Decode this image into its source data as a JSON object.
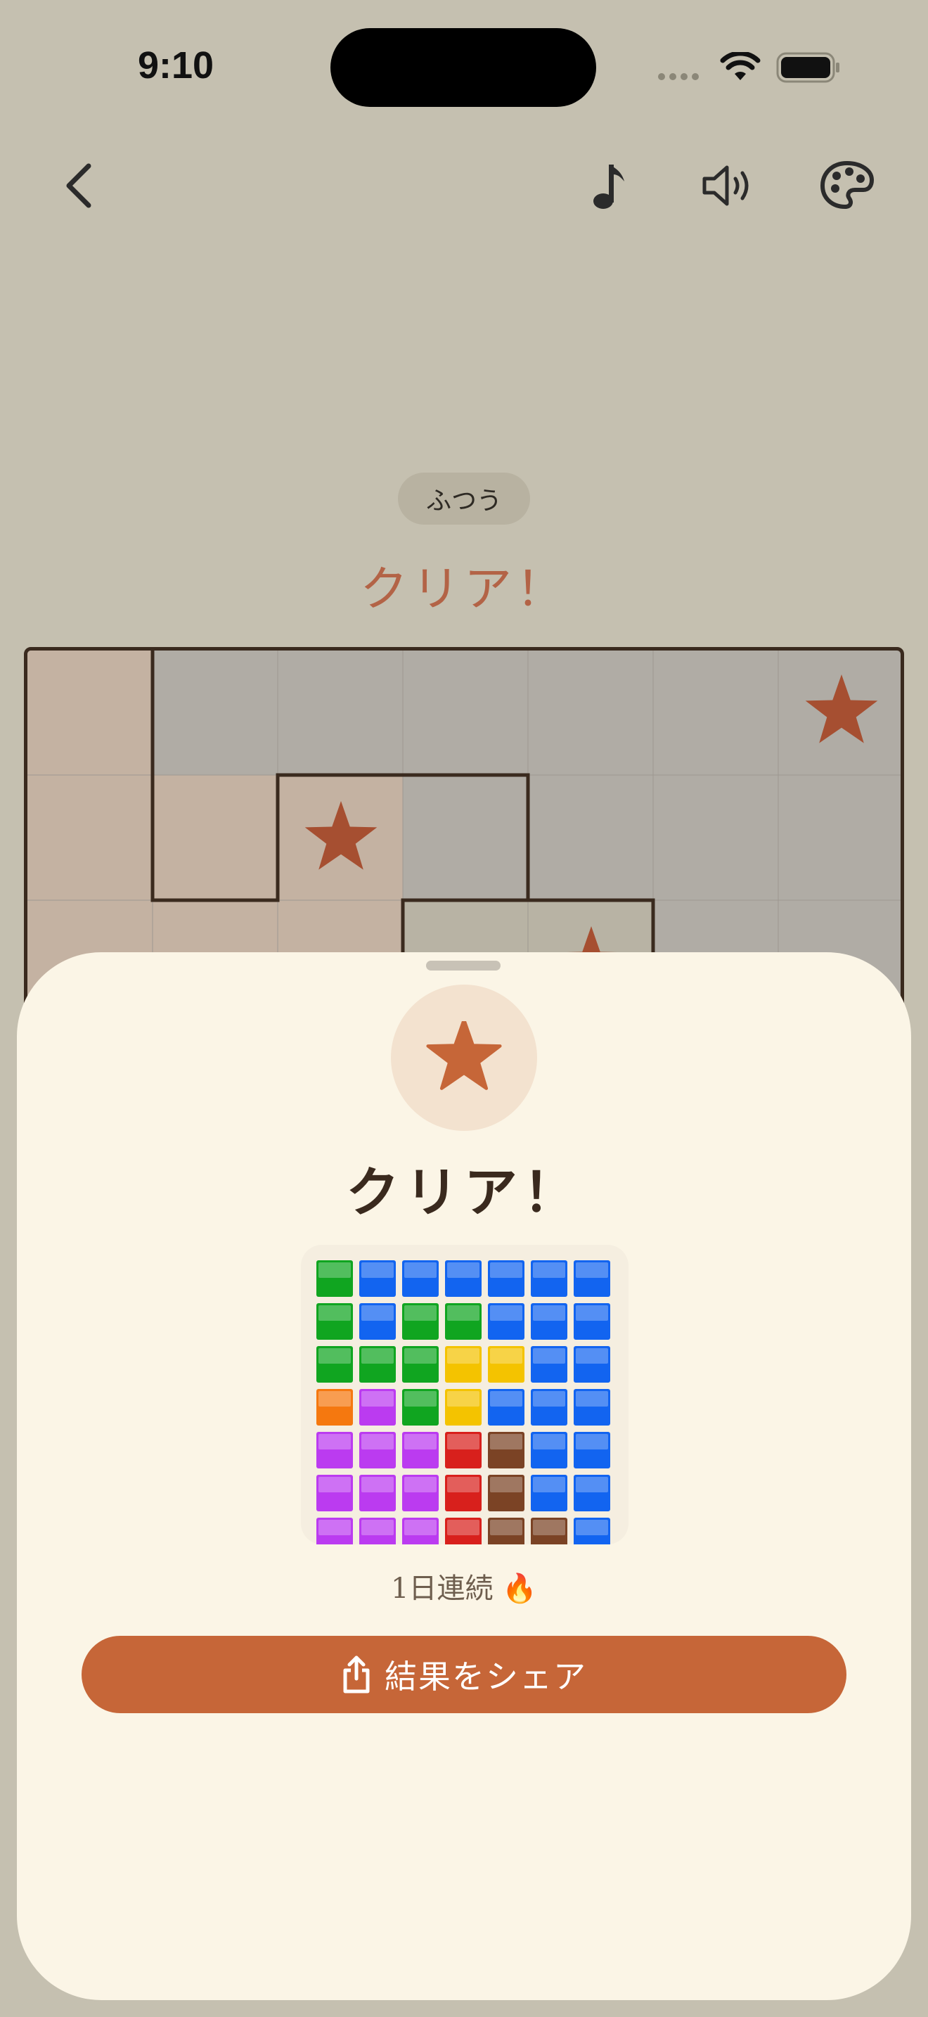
{
  "status_bar": {
    "time": "9:10"
  },
  "nav": {
    "back_icon": "chevron-left-icon",
    "music_icon": "music-note-icon",
    "sound_icon": "speaker-icon",
    "palette_icon": "palette-icon"
  },
  "board": {
    "difficulty": "ふつう",
    "title": "クリア！",
    "star_color": "#a64f31"
  },
  "result_sheet": {
    "title": "クリア！",
    "star_icon": "star-icon",
    "mosaic_rows": [
      [
        "green",
        "blue",
        "blue",
        "blue",
        "blue",
        "blue",
        "blue"
      ],
      [
        "green",
        "blue",
        "green",
        "green",
        "blue",
        "blue",
        "blue"
      ],
      [
        "green",
        "green",
        "green",
        "yellow",
        "yellow",
        "blue",
        "blue"
      ],
      [
        "orange",
        "purple",
        "green",
        "yellow",
        "blue",
        "blue",
        "blue"
      ],
      [
        "purple",
        "purple",
        "purple",
        "red",
        "brown",
        "blue",
        "blue"
      ],
      [
        "purple",
        "purple",
        "purple",
        "red",
        "brown",
        "blue",
        "blue"
      ],
      [
        "purple",
        "purple",
        "purple",
        "red",
        "brown",
        "brown",
        "blue"
      ]
    ],
    "streak_text": "1日連続 🔥",
    "share_label": "結果をシェア",
    "share_icon": "share-icon"
  },
  "colors": {
    "accent": "#c66638",
    "title_color": "#b36346",
    "tile_green": "#10a520",
    "tile_blue": "#1264f0",
    "tile_yellow": "#f4c300",
    "tile_orange": "#f5780f",
    "tile_purple": "#bb3bf0",
    "tile_red": "#d8201c",
    "tile_brown": "#7b4325"
  }
}
